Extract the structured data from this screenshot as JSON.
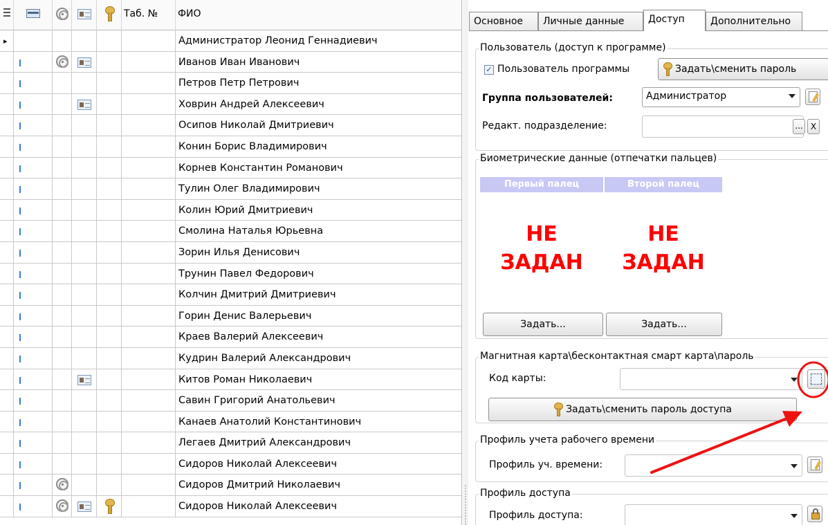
{
  "grid": {
    "header": {
      "tab_no": "Таб. №",
      "fio": "ФИО"
    },
    "rows": [
      {
        "name": "Администратор Леонид Геннадиевич",
        "fp": false,
        "card": false,
        "key": false,
        "current": true
      },
      {
        "name": "Иванов Иван Иванович",
        "fp": true,
        "card": true,
        "key": false
      },
      {
        "name": "Петров Петр Петрович",
        "fp": false,
        "card": false,
        "key": false
      },
      {
        "name": "Ховрин Андрей Алексеевич",
        "fp": false,
        "card": true,
        "key": false
      },
      {
        "name": "Осипов Николай Дмитриевич",
        "fp": false,
        "card": false,
        "key": false
      },
      {
        "name": "Конин Борис Владимирович",
        "fp": false,
        "card": false,
        "key": false
      },
      {
        "name": "Корнев Константин Романович",
        "fp": false,
        "card": false,
        "key": false
      },
      {
        "name": "Тулин Олег Владимирович",
        "fp": false,
        "card": false,
        "key": false
      },
      {
        "name": "Колин Юрий Дмитриевич",
        "fp": false,
        "card": false,
        "key": false
      },
      {
        "name": "Смолина Наталья Юрьевна",
        "fp": false,
        "card": false,
        "key": false
      },
      {
        "name": "Зорин Илья Денисович",
        "fp": false,
        "card": false,
        "key": false
      },
      {
        "name": "Трунин Павел Федорович",
        "fp": false,
        "card": false,
        "key": false
      },
      {
        "name": "Колчин Дмитрий Дмитриевич",
        "fp": false,
        "card": false,
        "key": false
      },
      {
        "name": "Горин Денис Валерьевич",
        "fp": false,
        "card": false,
        "key": false
      },
      {
        "name": "Краев Валерий Алексеевич",
        "fp": false,
        "card": false,
        "key": false
      },
      {
        "name": "Кудрин Валерий Александрович",
        "fp": false,
        "card": false,
        "key": false
      },
      {
        "name": "Китов Роман Николаевич",
        "fp": false,
        "card": true,
        "key": false
      },
      {
        "name": "Савин Григорий Анатольевич",
        "fp": false,
        "card": false,
        "key": false
      },
      {
        "name": "Канаев Анатолий Константинович",
        "fp": false,
        "card": false,
        "key": false
      },
      {
        "name": "Легаев Дмитрий Александрович",
        "fp": false,
        "card": false,
        "key": false
      },
      {
        "name": "Сидоров Николай Алексеевич",
        "fp": false,
        "card": false,
        "key": false
      },
      {
        "name": "Сидоров Дмитрий Николаевич",
        "fp": true,
        "card": false,
        "key": false
      },
      {
        "name": "Сидоров Николай Алексеевич",
        "fp": true,
        "card": true,
        "key": true
      }
    ]
  },
  "tabs": [
    "Основное",
    "Личные данные",
    "Доступ",
    "Дополнительно"
  ],
  "active_tab": "Доступ",
  "user_group": {
    "legend": "Пользователь (доступ к программе)",
    "program_user_label": "Пользователь программы",
    "program_user_checked": true,
    "set_password_button": "Задать\\сменить пароль",
    "group_label": "Группа пользователей:",
    "group_value": "Администратор",
    "dept_label": "Редакт. подразделение:",
    "dept_value": "",
    "ellipsis": "...",
    "clear": "X"
  },
  "biometric": {
    "legend": "Биометрические данные (отпечатки пальцев)",
    "first_finger": "Первый палец",
    "second_finger": "Второй палец",
    "first_status_line1": "НЕ",
    "first_status_line2": "ЗАДАН",
    "second_status_line1": "НЕ",
    "second_status_line2": "ЗАДАН",
    "set_first_button": "Задать...",
    "set_second_button": "Задать..."
  },
  "card": {
    "legend": "Магнитная карта\\бесконтактная смарт карта\\пароль",
    "code_label": "Код карты:",
    "code_value": "",
    "set_access_password_button": "Задать\\сменить пароль доступа"
  },
  "time_profile": {
    "legend": "Профиль учета рабочего времени",
    "label": "Профиль уч. времени:",
    "value": ""
  },
  "access_profile": {
    "legend": "Профиль доступа",
    "label": "Профиль доступа:",
    "value": ""
  },
  "colors": {
    "annotation_red": "#ee1111",
    "not_set_red": "#ff0000",
    "finger_header": "#c8c8f5"
  }
}
